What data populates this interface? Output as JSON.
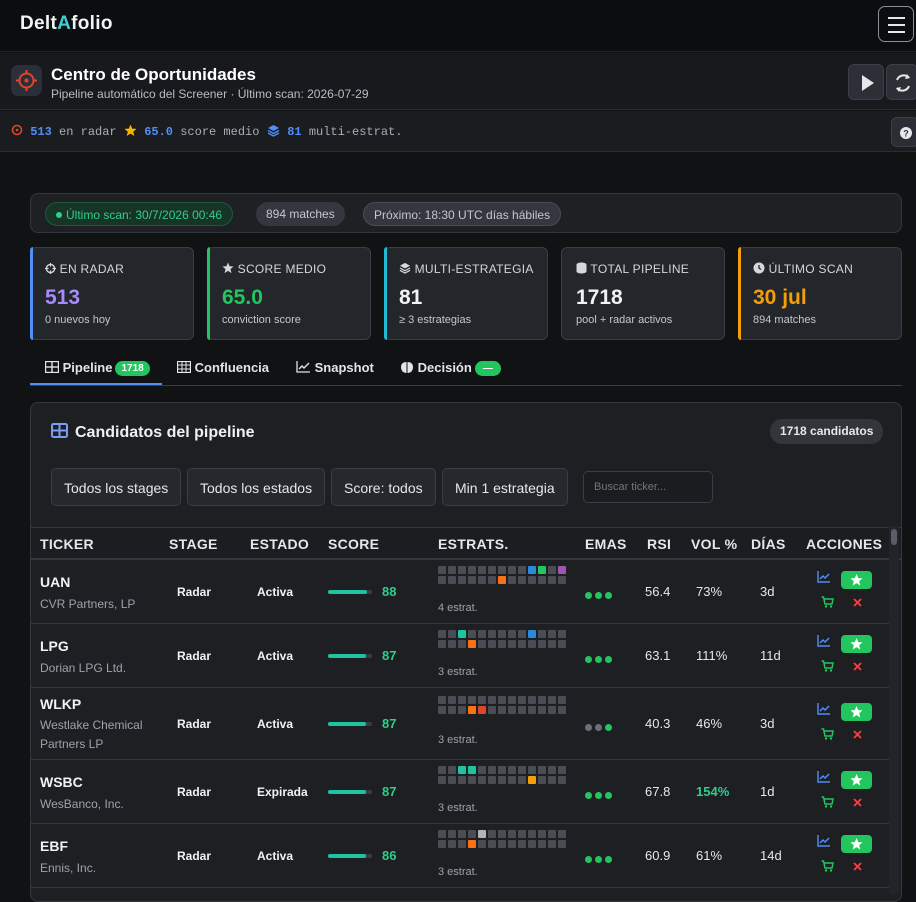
{
  "app": {
    "logo_left": "Delt",
    "logo_mid": "A",
    "logo_right": "folio"
  },
  "header": {
    "title": "Centro de Oportunidades",
    "subtitle": "Pipeline automático del Screener · Último scan: 2026-07-29"
  },
  "statbar": [
    {
      "value": "513",
      "label": "en radar",
      "color": "#4f8ff7"
    },
    {
      "value": "65.0",
      "label": "score medio",
      "color": "#4f8ff7"
    },
    {
      "value": "81",
      "label": "multi-estrat.",
      "color": "#4f8ff7"
    }
  ],
  "scan": {
    "last": "Último scan: 30/7/2026 00:46",
    "matches": "894 matches",
    "next": "Próximo: 18:30 UTC días hábiles"
  },
  "cards": [
    {
      "label": "EN RADAR",
      "value": "513",
      "sub": "0 nuevos hoy",
      "color": "#a78bfa",
      "accent": "#4f8ff7"
    },
    {
      "label": "SCORE MEDIO",
      "value": "65.0",
      "sub": "conviction score",
      "color": "#22c55e",
      "accent": "#22c55e"
    },
    {
      "label": "MULTI-ESTRATEGIA",
      "value": "81",
      "sub": "≥ 3 estrategias",
      "color": "#f1f2f4",
      "accent": "#22b8d6"
    },
    {
      "label": "TOTAL PIPELINE",
      "value": "1718",
      "sub": "pool + radar activos",
      "color": "#f1f2f4",
      "accent": "#3a3d44"
    },
    {
      "label": "ÚLTIMO SCAN",
      "value": "30 jul",
      "sub": "894 matches",
      "color": "#f59e0b",
      "accent": "#f59e0b"
    }
  ],
  "tabs": [
    {
      "label": "Pipeline",
      "badge": "1718"
    },
    {
      "label": "Confluencia"
    },
    {
      "label": "Snapshot"
    },
    {
      "label": "Decisión",
      "badge": "—"
    }
  ],
  "panel": {
    "title": "Candidatos del pipeline",
    "count": "1718 candidatos",
    "filters": [
      "Todos los stages",
      "Todos los estados",
      "Score: todos",
      "Min 1 estrategia"
    ],
    "search_placeholder": "Buscar ticker..."
  },
  "columns": [
    "TICKER",
    "STAGE",
    "ESTADO",
    "SCORE",
    "ESTRATS.",
    "EMAS",
    "RSI",
    "VOL %",
    "DÍAS",
    "ACCIONES"
  ],
  "rows": [
    {
      "ticker": "UAN",
      "name": "CVR Partners, LP",
      "stage": "Radar",
      "estado": "Activa",
      "score": 88,
      "score_text": "88",
      "nstrat": "4 estrat.",
      "rsi": "56.4",
      "vol": "73%",
      "vol_color": "#e6e7ea",
      "dias": "3d",
      "cells": {
        "9": "#2a8bdc",
        "10": "#22c55e",
        "12": "#9b59b6",
        "19": "#f97316"
      },
      "emas": [
        "#22c55e",
        "#22c55e",
        "#22c55e"
      ]
    },
    {
      "ticker": "LPG",
      "name": "Dorian LPG Ltd.",
      "stage": "Radar",
      "estado": "Activa",
      "score": 87,
      "score_text": "87",
      "nstrat": "3 estrat.",
      "rsi": "63.1",
      "vol": "111%",
      "vol_color": "#e6e7ea",
      "dias": "11d",
      "cells": {
        "2": "#1ec4a0",
        "9": "#2a8bdc",
        "16": "#f97316"
      },
      "emas": [
        "#22c55e",
        "#22c55e",
        "#22c55e"
      ]
    },
    {
      "ticker": "WLKP",
      "name": "Westlake Chemical Partners LP",
      "stage": "Radar",
      "estado": "Activa",
      "score": 87,
      "score_text": "87",
      "nstrat": "3 estrat.",
      "rsi": "40.3",
      "vol": "46%",
      "vol_color": "#e6e7ea",
      "dias": "3d",
      "cells": {
        "16": "#f97316",
        "17": "#e0452a"
      },
      "emas": [
        "#6b6f77",
        "#6b6f77",
        "#22c55e"
      ]
    },
    {
      "ticker": "WSBC",
      "name": "WesBanco, Inc.",
      "stage": "Radar",
      "estado": "Expirada",
      "score": 87,
      "score_text": "87",
      "nstrat": "3 estrat.",
      "rsi": "67.8",
      "vol": "154%",
      "vol_color": "#2fce8a",
      "dias": "1d",
      "cells": {
        "2": "#1ec4a0",
        "3": "#1ec4a0",
        "22": "#f59e0b"
      },
      "emas": [
        "#22c55e",
        "#22c55e",
        "#22c55e"
      ]
    },
    {
      "ticker": "EBF",
      "name": "Ennis, Inc.",
      "stage": "Radar",
      "estado": "Activa",
      "score": 86,
      "score_text": "86",
      "nstrat": "3 estrat.",
      "rsi": "60.9",
      "vol": "61%",
      "vol_color": "#e6e7ea",
      "dias": "14d",
      "cells": {
        "4": "#b0b3b8",
        "16": "#f97316"
      },
      "emas": [
        "#22c55e",
        "#22c55e",
        "#22c55e"
      ]
    }
  ]
}
